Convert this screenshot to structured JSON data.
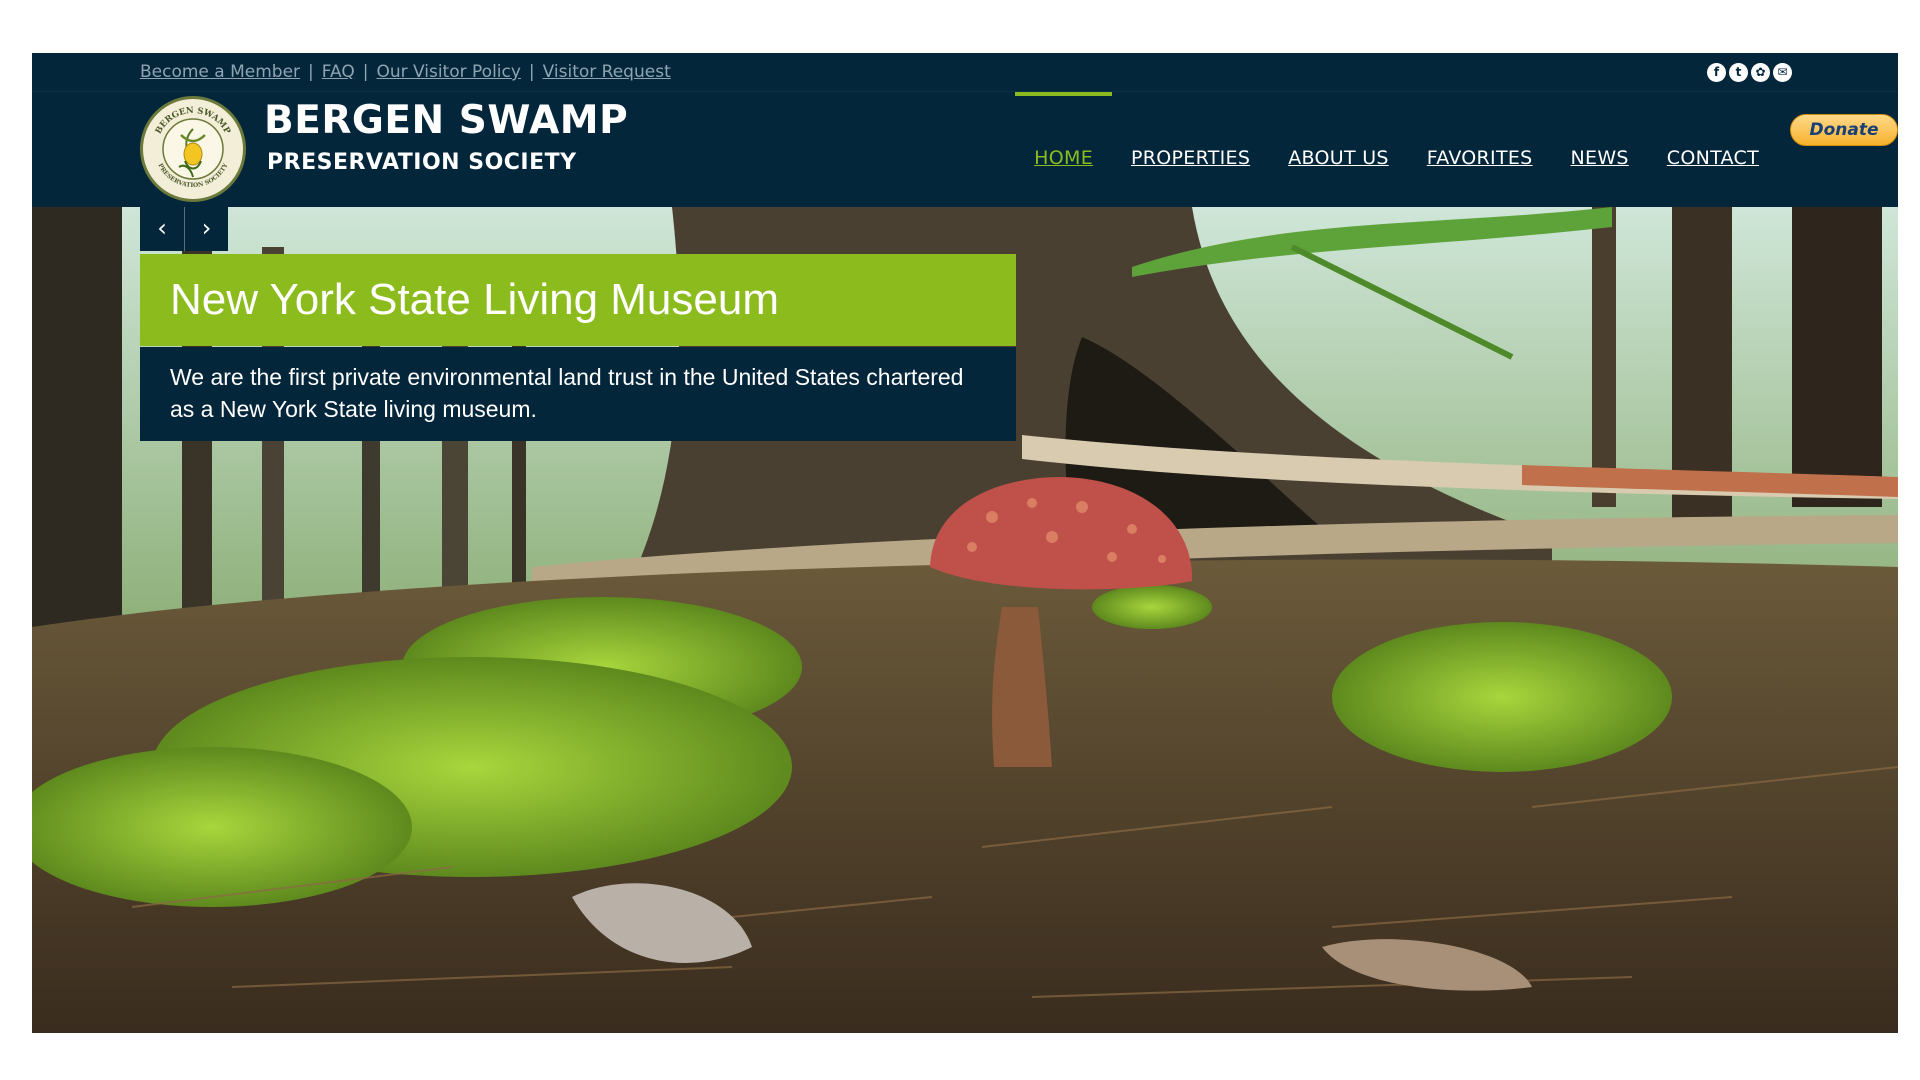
{
  "utility": {
    "links": [
      {
        "label": "Become a Member"
      },
      {
        "label": "FAQ"
      },
      {
        "label": "Our Visitor Policy"
      },
      {
        "label": "Visitor Request"
      }
    ],
    "separator": "|",
    "social": [
      {
        "icon": "facebook-icon",
        "glyph": "f"
      },
      {
        "icon": "twitter-icon",
        "glyph": "t"
      },
      {
        "icon": "instagram-icon",
        "glyph": "✿"
      },
      {
        "icon": "email-icon",
        "glyph": "✉"
      }
    ]
  },
  "header": {
    "title": "BERGEN SWAMP",
    "subtitle": "PRESERVATION SOCIETY",
    "logo": {
      "icon": "lady-slipper-seal-logo",
      "ring_top": "BERGEN SWAMP",
      "ring_bottom": "PRESERVATION SOCIETY"
    }
  },
  "nav": {
    "items": [
      {
        "label": "HOME",
        "active": true
      },
      {
        "label": "PROPERTIES",
        "active": false
      },
      {
        "label": "ABOUT US",
        "active": false
      },
      {
        "label": "FAVORITES",
        "active": false
      },
      {
        "label": "NEWS",
        "active": false
      },
      {
        "label": "CONTACT",
        "active": false
      }
    ],
    "donate_label": "Donate"
  },
  "hero": {
    "prev_icon": "‹",
    "next_icon": "›",
    "title": "New York State Living Museum",
    "body": "We are the first private environmental land trust in the United States chartered as a New York State living museum."
  },
  "colors": {
    "navy": "#04263a",
    "accent_green": "#8cbb1e",
    "donate_gold": "#f7b22c"
  }
}
